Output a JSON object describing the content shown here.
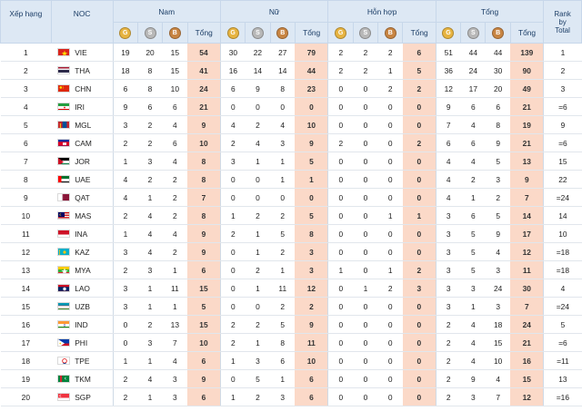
{
  "headers": {
    "rank": "Xếp hạng",
    "noc": "NOC",
    "groups": [
      "Nam",
      "Nữ",
      "Hỗn hợp",
      "Tổng"
    ],
    "rank_by_total": [
      "Rank",
      "by",
      "Total"
    ],
    "medal_letters": [
      "G",
      "S",
      "B"
    ],
    "total_label": "Tổng"
  },
  "medal_colors": {
    "gold": "#e7b441",
    "silver": "#b8b8b8",
    "bronze": "#c88543",
    "total_bg": "#fbd9c8",
    "header_bg": "#dde8f4"
  },
  "rows": [
    {
      "rank": "1",
      "code": "VIE",
      "flag": "vie-flag",
      "men": [
        "19",
        "20",
        "15",
        "54"
      ],
      "women": [
        "30",
        "22",
        "27",
        "79"
      ],
      "mixed": [
        "2",
        "2",
        "2",
        "6"
      ],
      "total": [
        "51",
        "44",
        "44",
        "139"
      ],
      "rbt": "1"
    },
    {
      "rank": "2",
      "code": "THA",
      "flag": "tha-flag",
      "men": [
        "18",
        "8",
        "15",
        "41"
      ],
      "women": [
        "16",
        "14",
        "14",
        "44"
      ],
      "mixed": [
        "2",
        "2",
        "1",
        "5"
      ],
      "total": [
        "36",
        "24",
        "30",
        "90"
      ],
      "rbt": "2"
    },
    {
      "rank": "3",
      "code": "CHN",
      "flag": "chn-flag",
      "men": [
        "6",
        "8",
        "10",
        "24"
      ],
      "women": [
        "6",
        "9",
        "8",
        "23"
      ],
      "mixed": [
        "0",
        "0",
        "2",
        "2"
      ],
      "total": [
        "12",
        "17",
        "20",
        "49"
      ],
      "rbt": "3"
    },
    {
      "rank": "4",
      "code": "IRI",
      "flag": "iri-flag",
      "men": [
        "9",
        "6",
        "6",
        "21"
      ],
      "women": [
        "0",
        "0",
        "0",
        "0"
      ],
      "mixed": [
        "0",
        "0",
        "0",
        "0"
      ],
      "total": [
        "9",
        "6",
        "6",
        "21"
      ],
      "rbt": "=6"
    },
    {
      "rank": "5",
      "code": "MGL",
      "flag": "mgl-flag",
      "men": [
        "3",
        "2",
        "4",
        "9"
      ],
      "women": [
        "4",
        "2",
        "4",
        "10"
      ],
      "mixed": [
        "0",
        "0",
        "0",
        "0"
      ],
      "total": [
        "7",
        "4",
        "8",
        "19"
      ],
      "rbt": "9"
    },
    {
      "rank": "6",
      "code": "CAM",
      "flag": "cam-flag",
      "men": [
        "2",
        "2",
        "6",
        "10"
      ],
      "women": [
        "2",
        "4",
        "3",
        "9"
      ],
      "mixed": [
        "2",
        "0",
        "0",
        "2"
      ],
      "total": [
        "6",
        "6",
        "9",
        "21"
      ],
      "rbt": "=6"
    },
    {
      "rank": "7",
      "code": "JOR",
      "flag": "jor-flag",
      "men": [
        "1",
        "3",
        "4",
        "8"
      ],
      "women": [
        "3",
        "1",
        "1",
        "5"
      ],
      "mixed": [
        "0",
        "0",
        "0",
        "0"
      ],
      "total": [
        "4",
        "4",
        "5",
        "13"
      ],
      "rbt": "15"
    },
    {
      "rank": "8",
      "code": "UAE",
      "flag": "uae-flag",
      "men": [
        "4",
        "2",
        "2",
        "8"
      ],
      "women": [
        "0",
        "0",
        "1",
        "1"
      ],
      "mixed": [
        "0",
        "0",
        "0",
        "0"
      ],
      "total": [
        "4",
        "2",
        "3",
        "9"
      ],
      "rbt": "22"
    },
    {
      "rank": "9",
      "code": "QAT",
      "flag": "qat-flag",
      "men": [
        "4",
        "1",
        "2",
        "7"
      ],
      "women": [
        "0",
        "0",
        "0",
        "0"
      ],
      "mixed": [
        "0",
        "0",
        "0",
        "0"
      ],
      "total": [
        "4",
        "1",
        "2",
        "7"
      ],
      "rbt": "=24"
    },
    {
      "rank": "10",
      "code": "MAS",
      "flag": "mas-flag",
      "men": [
        "2",
        "4",
        "2",
        "8"
      ],
      "women": [
        "1",
        "2",
        "2",
        "5"
      ],
      "mixed": [
        "0",
        "0",
        "1",
        "1"
      ],
      "total": [
        "3",
        "6",
        "5",
        "14"
      ],
      "rbt": "14"
    },
    {
      "rank": "11",
      "code": "INA",
      "flag": "ina-flag",
      "men": [
        "1",
        "4",
        "4",
        "9"
      ],
      "women": [
        "2",
        "1",
        "5",
        "8"
      ],
      "mixed": [
        "0",
        "0",
        "0",
        "0"
      ],
      "total": [
        "3",
        "5",
        "9",
        "17"
      ],
      "rbt": "10"
    },
    {
      "rank": "12",
      "code": "KAZ",
      "flag": "kaz-flag",
      "men": [
        "3",
        "4",
        "2",
        "9"
      ],
      "women": [
        "0",
        "1",
        "2",
        "3"
      ],
      "mixed": [
        "0",
        "0",
        "0",
        "0"
      ],
      "total": [
        "3",
        "5",
        "4",
        "12"
      ],
      "rbt": "=18"
    },
    {
      "rank": "13",
      "code": "MYA",
      "flag": "mya-flag",
      "men": [
        "2",
        "3",
        "1",
        "6"
      ],
      "women": [
        "0",
        "2",
        "1",
        "3"
      ],
      "mixed": [
        "1",
        "0",
        "1",
        "2"
      ],
      "total": [
        "3",
        "5",
        "3",
        "11"
      ],
      "rbt": "=18"
    },
    {
      "rank": "14",
      "code": "LAO",
      "flag": "lao-flag",
      "men": [
        "3",
        "1",
        "11",
        "15"
      ],
      "women": [
        "0",
        "1",
        "11",
        "12"
      ],
      "mixed": [
        "0",
        "1",
        "2",
        "3"
      ],
      "total": [
        "3",
        "3",
        "24",
        "30"
      ],
      "rbt": "4"
    },
    {
      "rank": "15",
      "code": "UZB",
      "flag": "uzb-flag",
      "men": [
        "3",
        "1",
        "1",
        "5"
      ],
      "women": [
        "0",
        "0",
        "2",
        "2"
      ],
      "mixed": [
        "0",
        "0",
        "0",
        "0"
      ],
      "total": [
        "3",
        "1",
        "3",
        "7"
      ],
      "rbt": "=24"
    },
    {
      "rank": "16",
      "code": "IND",
      "flag": "ind-flag",
      "men": [
        "0",
        "2",
        "13",
        "15"
      ],
      "women": [
        "2",
        "2",
        "5",
        "9"
      ],
      "mixed": [
        "0",
        "0",
        "0",
        "0"
      ],
      "total": [
        "2",
        "4",
        "18",
        "24"
      ],
      "rbt": "5"
    },
    {
      "rank": "17",
      "code": "PHI",
      "flag": "phi-flag",
      "men": [
        "0",
        "3",
        "7",
        "10"
      ],
      "women": [
        "2",
        "1",
        "8",
        "11"
      ],
      "mixed": [
        "0",
        "0",
        "0",
        "0"
      ],
      "total": [
        "2",
        "4",
        "15",
        "21"
      ],
      "rbt": "=6"
    },
    {
      "rank": "18",
      "code": "TPE",
      "flag": "tpe-flag",
      "men": [
        "1",
        "1",
        "4",
        "6"
      ],
      "women": [
        "1",
        "3",
        "6",
        "10"
      ],
      "mixed": [
        "0",
        "0",
        "0",
        "0"
      ],
      "total": [
        "2",
        "4",
        "10",
        "16"
      ],
      "rbt": "=11"
    },
    {
      "rank": "19",
      "code": "TKM",
      "flag": "tkm-flag",
      "men": [
        "2",
        "4",
        "3",
        "9"
      ],
      "women": [
        "0",
        "5",
        "1",
        "6"
      ],
      "mixed": [
        "0",
        "0",
        "0",
        "0"
      ],
      "total": [
        "2",
        "9",
        "4",
        "15"
      ],
      "rbt": "13"
    },
    {
      "rank": "20",
      "code": "SGP",
      "flag": "sgp-flag",
      "men": [
        "2",
        "1",
        "3",
        "6"
      ],
      "women": [
        "1",
        "2",
        "3",
        "6"
      ],
      "mixed": [
        "0",
        "0",
        "0",
        "0"
      ],
      "total": [
        "2",
        "3",
        "7",
        "12"
      ],
      "rbt": "=16"
    }
  ]
}
